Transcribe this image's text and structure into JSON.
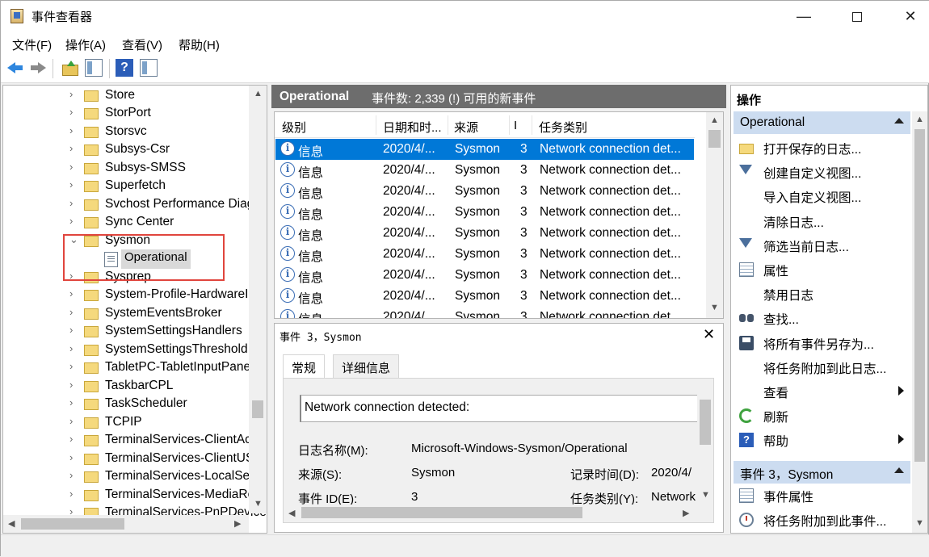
{
  "window": {
    "title": "事件查看器"
  },
  "menu": [
    "文件(F)",
    "操作(A)",
    "查看(V)",
    "帮助(H)"
  ],
  "toolbar": {
    "help_glyph": "?"
  },
  "tree": {
    "items": [
      {
        "label": "Store",
        "expanded": false
      },
      {
        "label": "StorPort",
        "expanded": false
      },
      {
        "label": "Storsvc",
        "expanded": false
      },
      {
        "label": "Subsys-Csr",
        "expanded": false
      },
      {
        "label": "Subsys-SMSS",
        "expanded": false
      },
      {
        "label": "Superfetch",
        "expanded": false
      },
      {
        "label": "Svchost Performance Diag",
        "expanded": false
      },
      {
        "label": "Sync Center",
        "expanded": false
      },
      {
        "label": "Sysmon",
        "expanded": true
      },
      {
        "label": "Sysprep",
        "expanded": false
      },
      {
        "label": "System-Profile-HardwareId",
        "expanded": false
      },
      {
        "label": "SystemEventsBroker",
        "expanded": false
      },
      {
        "label": "SystemSettingsHandlers",
        "expanded": false
      },
      {
        "label": "SystemSettingsThreshold",
        "expanded": false
      },
      {
        "label": "TabletPC-TabletInputPanel",
        "expanded": false
      },
      {
        "label": "TaskbarCPL",
        "expanded": false
      },
      {
        "label": "TaskScheduler",
        "expanded": false
      },
      {
        "label": "TCPIP",
        "expanded": false
      },
      {
        "label": "TerminalServices-ClientActiveX",
        "expanded": false
      },
      {
        "label": "TerminalServices-ClientUSB",
        "expanded": false
      },
      {
        "label": "TerminalServices-LocalSession",
        "expanded": false
      },
      {
        "label": "TerminalServices-MediaRedirection",
        "expanded": false
      },
      {
        "label": "TerminalServices-PnPDevices",
        "expanded": false
      }
    ],
    "selected_child": "Operational"
  },
  "events": {
    "header_name": "Operational",
    "header_count": "事件数: 2,339 (!) 可用的新事件",
    "columns": [
      "级别",
      "日期和时...",
      "来源",
      "I",
      "任务类别"
    ],
    "rows": [
      {
        "level": "信息",
        "date": "2020/4/...",
        "source": "Sysmon",
        "id": "3",
        "task": "Network connection det...",
        "selected": true
      },
      {
        "level": "信息",
        "date": "2020/4/...",
        "source": "Sysmon",
        "id": "3",
        "task": "Network connection det..."
      },
      {
        "level": "信息",
        "date": "2020/4/...",
        "source": "Sysmon",
        "id": "3",
        "task": "Network connection det..."
      },
      {
        "level": "信息",
        "date": "2020/4/...",
        "source": "Sysmon",
        "id": "3",
        "task": "Network connection det..."
      },
      {
        "level": "信息",
        "date": "2020/4/...",
        "source": "Sysmon",
        "id": "3",
        "task": "Network connection det..."
      },
      {
        "level": "信息",
        "date": "2020/4/...",
        "source": "Sysmon",
        "id": "3",
        "task": "Network connection det..."
      },
      {
        "level": "信息",
        "date": "2020/4/...",
        "source": "Sysmon",
        "id": "3",
        "task": "Network connection det..."
      },
      {
        "level": "信息",
        "date": "2020/4/...",
        "source": "Sysmon",
        "id": "3",
        "task": "Network connection det..."
      },
      {
        "level": "信息",
        "date": "2020/4/...",
        "source": "Sysmon",
        "id": "3",
        "task": "Network connection det..."
      }
    ]
  },
  "detail": {
    "title": "事件 3，Sysmon",
    "tabs": [
      "常规",
      "详细信息"
    ],
    "message": "Network connection detected:",
    "fields": {
      "log_name_label": "日志名称(M):",
      "log_name_value": "Microsoft-Windows-Sysmon/Operational",
      "source_label": "来源(S):",
      "source_value": "Sysmon",
      "logged_label": "记录时间(D):",
      "logged_value": "2020/4/",
      "event_id_label": "事件 ID(E):",
      "event_id_value": "3",
      "task_label": "任务类别(Y):",
      "task_value": "Network"
    }
  },
  "actions": {
    "title": "操作",
    "section1": "Operational",
    "items1": [
      {
        "label": "打开保存的日志...",
        "icon": "folder-open-icon"
      },
      {
        "label": "创建自定义视图...",
        "icon": "funnel-icon"
      },
      {
        "label": "导入自定义视图...",
        "icon": ""
      },
      {
        "label": "清除日志...",
        "icon": ""
      },
      {
        "label": "筛选当前日志...",
        "icon": "funnel-icon"
      },
      {
        "label": "属性",
        "icon": "properties-icon"
      },
      {
        "label": "禁用日志",
        "icon": ""
      },
      {
        "label": "查找...",
        "icon": "binoculars-icon"
      },
      {
        "label": "将所有事件另存为...",
        "icon": "save-icon"
      },
      {
        "label": "将任务附加到此日志...",
        "icon": ""
      },
      {
        "label": "查看",
        "icon": "",
        "submenu": true
      },
      {
        "label": "刷新",
        "icon": "refresh-icon"
      },
      {
        "label": "帮助",
        "icon": "help-icon",
        "submenu": true
      }
    ],
    "section2": "事件 3，Sysmon",
    "items2": [
      {
        "label": "事件属性",
        "icon": "properties-icon"
      },
      {
        "label": "将任务附加到此事件...",
        "icon": "scheduler-icon"
      }
    ]
  }
}
